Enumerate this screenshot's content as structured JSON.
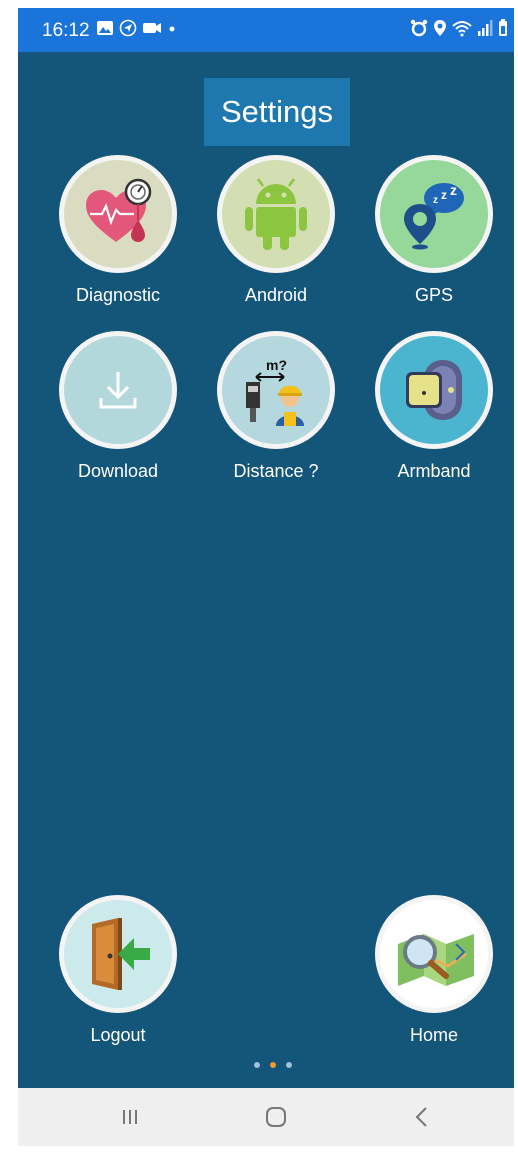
{
  "status_bar": {
    "time": "16:12",
    "left_icons": [
      "image-icon",
      "location-arrow-icon",
      "video-icon",
      "dot-icon"
    ],
    "right_icons": [
      "alarm-icon",
      "location-pin-icon",
      "wifi-icon",
      "signal-icon",
      "battery-icon"
    ]
  },
  "header": {
    "title": "Settings"
  },
  "tiles": [
    {
      "label": "Diagnostic",
      "icon": "heart-gauge-icon",
      "bg": "#d9dcc0"
    },
    {
      "label": "Android",
      "icon": "android-icon",
      "bg": "#d3deb3"
    },
    {
      "label": "GPS",
      "icon": "gps-sleep-icon",
      "bg": "#96d79a"
    },
    {
      "label": "Download",
      "icon": "download-icon",
      "bg": "#b3d8db"
    },
    {
      "label": "Distance ?",
      "icon": "distance-worker-icon",
      "bg": "#b4d8de"
    },
    {
      "label": "Armband",
      "icon": "armband-icon",
      "bg": "#4bb5d0"
    },
    {
      "label": "Logout",
      "icon": "door-exit-icon",
      "bg": "#cce9ec"
    },
    {
      "label": "Home",
      "icon": "map-magnifier-icon",
      "bg": "#ffffff"
    }
  ],
  "pager": {
    "pages": 3,
    "active_page": 2
  },
  "nav_bar": {
    "buttons": [
      "recents-icon",
      "home-icon",
      "back-icon"
    ]
  },
  "colors": {
    "background": "#14557a",
    "status_bar": "#1a74d9",
    "title_bg": "#1e77ae",
    "pager_active": "#f39a2c"
  }
}
